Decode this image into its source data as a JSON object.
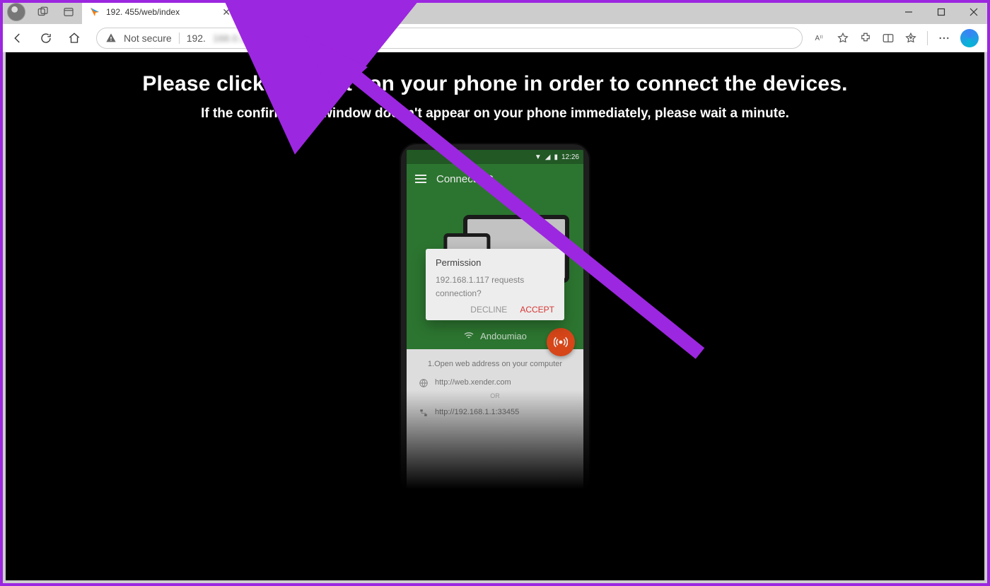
{
  "browser": {
    "tab_title": "192.            455/web/index",
    "not_secure": "Not secure",
    "url_prefix": "192.",
    "url_suffix": "55/web/index.html"
  },
  "page": {
    "headline": "Please click \"Accept\" on your phone in order to connect the devices.",
    "subhead": "If the confirmation window doesn't appear on your phone immediately, please wait a minute."
  },
  "phone": {
    "time": "12:26",
    "appbar_title": "Connect PC",
    "wifi_name": "Andoumiao",
    "dialog": {
      "title": "Permission",
      "body": "192.168.1.117 requests connection?",
      "decline": "DECLINE",
      "accept": "ACCEPT"
    },
    "sheet": {
      "step": "1.Open web address on your computer",
      "url1": "http://web.xender.com",
      "or": "OR",
      "url2": "http://192.168.1.1:33455"
    }
  }
}
